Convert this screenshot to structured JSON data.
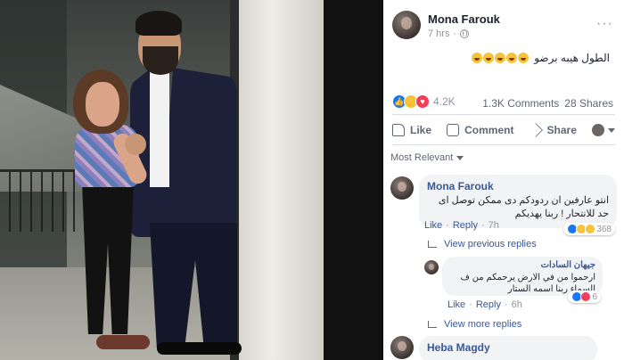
{
  "post": {
    "author": "Mona Farouk",
    "time": "7 hrs",
    "privacy_icon": "globe-icon",
    "more_icon": "more-options-icon",
    "text": "الطول هيبه برضو",
    "emoji_count": 5,
    "reaction_count": "4.2K",
    "comments_count": "1.3K Comments",
    "shares_count": "28 Shares"
  },
  "actions": {
    "like": "Like",
    "comment": "Comment",
    "share": "Share"
  },
  "comments_filter": "Most Relevant",
  "comments": [
    {
      "author": "Mona Farouk",
      "text": "انتو عارفين ان ردودكم دى ممكن توصل اى حد للانتحار ! ربنا يهديكم",
      "reaction_count": "368",
      "like": "Like",
      "reply": "Reply",
      "time": "7h"
    }
  ],
  "view_previous_replies": "View previous replies",
  "reply": {
    "author": "جيهان السادات",
    "text": "ارحموا من في الارض يرحمكم من ف السماء ربنا اسمه الستار",
    "reaction_count": "6",
    "like": "Like",
    "reply": "Reply",
    "time": "6h"
  },
  "view_more_replies": "View more replies",
  "next_comment_author": "Heba Magdy",
  "colors": {
    "link_blue": "#385898",
    "like_blue": "#1877f2",
    "haha_yellow": "#f7c33b",
    "love_red": "#f33e58",
    "meta_gray": "#90949c"
  }
}
